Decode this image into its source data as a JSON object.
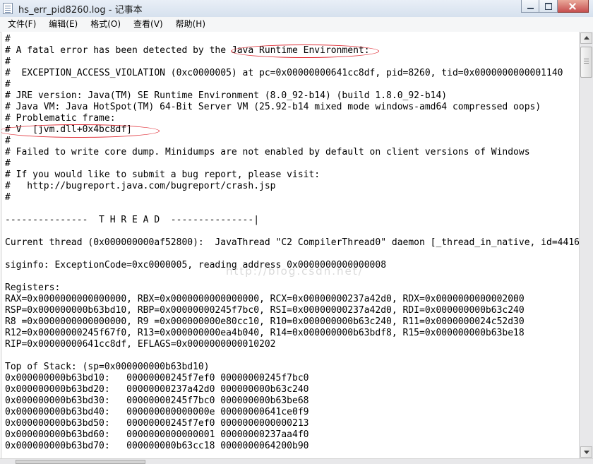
{
  "window": {
    "title": "hs_err_pid8260.log - 记事本",
    "buttons": {
      "minimize": "minimize-icon",
      "maximize": "maximize-icon",
      "close": "close-icon"
    }
  },
  "menu": [
    {
      "label": "文件(F)"
    },
    {
      "label": "编辑(E)"
    },
    {
      "label": "格式(O)"
    },
    {
      "label": "查看(V)"
    },
    {
      "label": "帮助(H)"
    }
  ],
  "document": {
    "lines": [
      "#",
      "# A fatal error has been detected by the Java Runtime Environment:",
      "#",
      "#  EXCEPTION_ACCESS_VIOLATION (0xc0000005) at pc=0x00000000641cc8df, pid=8260, tid=0x0000000000001140",
      "#",
      "# JRE version: Java(TM) SE Runtime Environment (8.0_92-b14) (build 1.8.0_92-b14)",
      "# Java VM: Java HotSpot(TM) 64-Bit Server VM (25.92-b14 mixed mode windows-amd64 compressed oops)",
      "# Problematic frame:",
      "# V  [jvm.dll+0x4bc8df]",
      "#",
      "# Failed to write core dump. Minidumps are not enabled by default on client versions of Windows",
      "#",
      "# If you would like to submit a bug report, please visit:",
      "#   http://bugreport.java.com/bugreport/crash.jsp",
      "#",
      "",
      "---------------  T H R E A D  ---------------|",
      "",
      "Current thread (0x000000000af52800):  JavaThread \"C2 CompilerThread0\" daemon [_thread_in_native, id=4416",
      "",
      "siginfo: ExceptionCode=0xc0000005, reading address 0x0000000000000008",
      "",
      "Registers:",
      "RAX=0x0000000000000000, RBX=0x0000000000000000, RCX=0x00000000237a42d0, RDX=0x0000000000002000",
      "RSP=0x000000000b63bd10, RBP=0x00000000245f7bc0, RSI=0x00000000237a42d0, RDI=0x000000000b63c240",
      "R8 =0x0000000000000000, R9 =0x000000000e80cc10, R10=0x000000000b63c240, R11=0x0000000024c52d30",
      "R12=0x00000000245f67f0, R13=0x000000000ea4b040, R14=0x000000000b63bdf8, R15=0x000000000b63be18",
      "RIP=0x00000000641cc8df, EFLAGS=0x0000000000010202",
      "",
      "Top of Stack: (sp=0x000000000b63bd10)",
      "0x000000000b63bd10:   00000000245f7ef0 00000000245f7bc0",
      "0x000000000b63bd20:   00000000237a42d0 000000000b63c240",
      "0x000000000b63bd30:   00000000245f7bc0 000000000b63be68",
      "0x000000000b63bd40:   000000000000000e 00000000641ce0f9",
      "0x000000000b63bd50:   00000000245f7ef0 0000000000000213",
      "0x000000000b63bd60:   0000000000000001 00000000237aa4f0",
      "0x000000000b63bd70:   000000000b63cc18 0000000064200b90"
    ]
  },
  "watermark": "http://blog.csdn.net/",
  "colors": {
    "annotation": "#e0323a",
    "titlebar": "#dbe5f1"
  }
}
